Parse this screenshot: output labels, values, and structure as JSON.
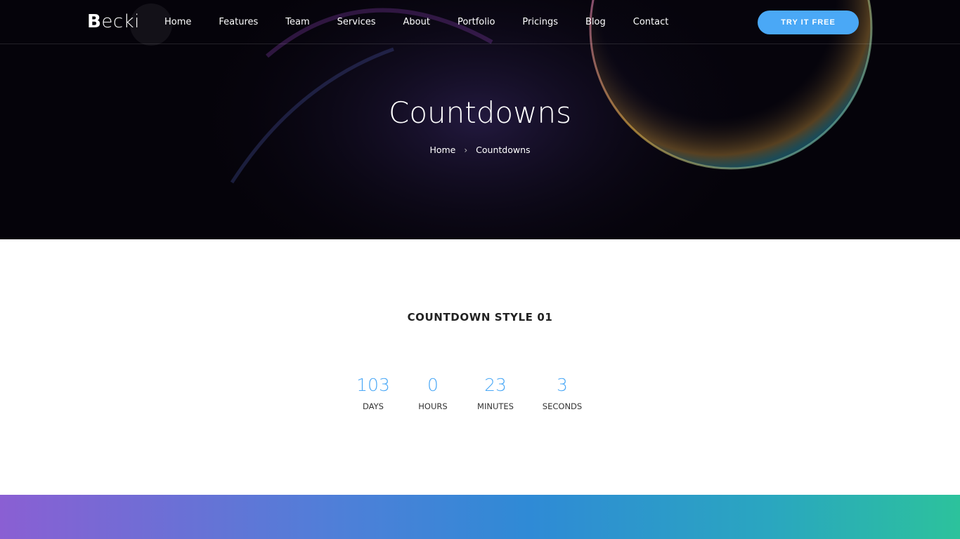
{
  "brand": {
    "logo_bold": "B",
    "logo_rest": "ecki"
  },
  "nav": {
    "items": [
      "Home",
      "Features",
      "Team",
      "Services",
      "About",
      "Portfolio",
      "Pricings",
      "Blog",
      "Contact"
    ],
    "cta_label": "TRY IT FREE"
  },
  "hero": {
    "title": "Countdowns",
    "breadcrumb": {
      "home": "Home",
      "separator": "›",
      "current": "Countdowns"
    }
  },
  "countdown": {
    "title": "COUNTDOWN STYLE 01",
    "units": [
      {
        "value": "103",
        "label": "DAYS"
      },
      {
        "value": "0",
        "label": "HOURS"
      },
      {
        "value": "23",
        "label": "MINUTES"
      },
      {
        "value": "3",
        "label": "SECONDS"
      }
    ]
  },
  "colors": {
    "accent": "#4aa8f6",
    "hero_bg": "#05030a",
    "gradient_start": "#8a5fd3",
    "gradient_end": "#2cc29c"
  }
}
